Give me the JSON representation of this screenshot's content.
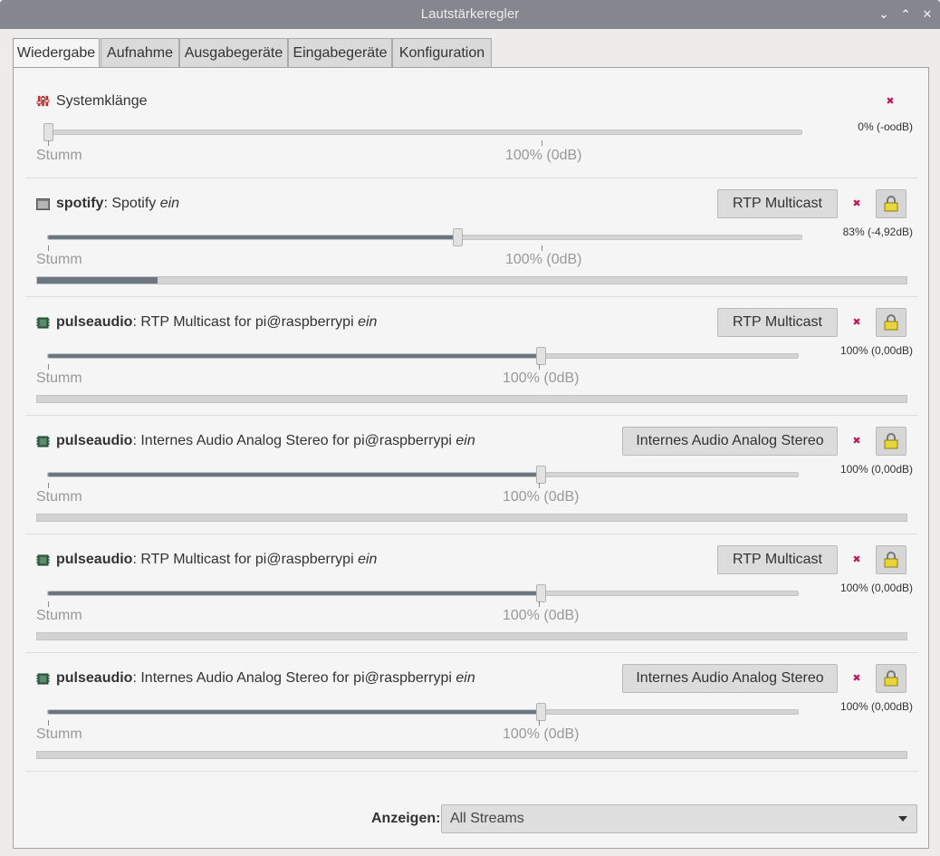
{
  "window": {
    "title": "Lautstärkeregler",
    "buttons": {
      "minimize": "⌄",
      "maximize": "⌃",
      "close": "✕"
    }
  },
  "tabs": [
    {
      "label": "Wiedergabe",
      "active": true
    },
    {
      "label": "Aufnahme"
    },
    {
      "label": "Ausgabegeräte"
    },
    {
      "label": "Eingabegeräte"
    },
    {
      "label": "Konfiguration"
    }
  ],
  "scale": {
    "min_label": "Stumm",
    "mid_label": "100% (0dB)"
  },
  "system": {
    "label": "Systemklänge",
    "volume_text": "0% (-oodB)",
    "volume_fraction": 0.0
  },
  "streams": [
    {
      "app": "spotify",
      "name": "Spotify",
      "state": "ein",
      "device": "RTP Multicast",
      "volume_text": "83% (-4,92dB)",
      "volume_fraction": 0.83,
      "meter_fraction": 0.14
    },
    {
      "app": "pulseaudio",
      "name": "RTP Multicast for pi@raspberrypi",
      "state": "ein",
      "device": "RTP Multicast",
      "volume_text": "100% (0,00dB)",
      "volume_fraction": 1.0,
      "meter_fraction": 0
    },
    {
      "app": "pulseaudio",
      "name": "Internes Audio Analog Stereo for pi@raspberrypi",
      "state": "ein",
      "device": "Internes Audio Analog Stereo",
      "volume_text": "100% (0,00dB)",
      "volume_fraction": 1.0,
      "meter_fraction": 0
    },
    {
      "app": "pulseaudio",
      "name": "RTP Multicast for pi@raspberrypi",
      "state": "ein",
      "device": "RTP Multicast",
      "volume_text": "100% (0,00dB)",
      "volume_fraction": 1.0,
      "meter_fraction": 0
    },
    {
      "app": "pulseaudio",
      "name": "Internes Audio Analog Stereo for pi@raspberrypi",
      "state": "ein",
      "device": "Internes Audio Analog Stereo",
      "volume_text": "100% (0,00dB)",
      "volume_fraction": 1.0,
      "meter_fraction": 0
    }
  ],
  "footer": {
    "label": "Anzeigen:",
    "selected": "All Streams"
  },
  "icons": {
    "system": "equalizer-icon",
    "spotify": "window-icon",
    "pulseaudio": "chip-icon",
    "mute": "mute-icon",
    "lock": "lock-icon"
  },
  "colors": {
    "accent": "#6c7683",
    "mute": "#c2185b",
    "lock": "#e8d53a"
  }
}
